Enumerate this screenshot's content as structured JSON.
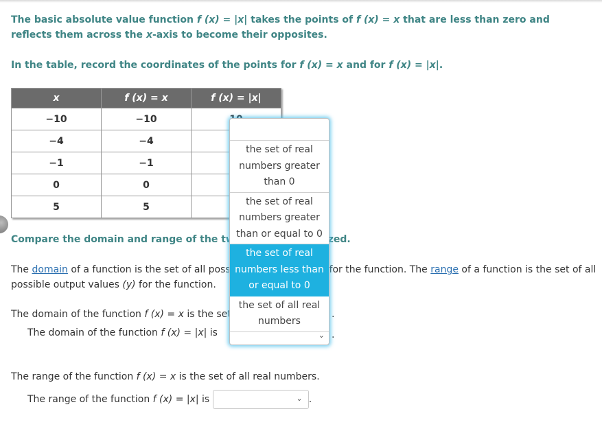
{
  "intro": {
    "text_a": "The basic absolute value function ",
    "fx_abs": "f (x) = |x|",
    "text_b": " takes the points of ",
    "fx_id": "f (x) = x",
    "text_c": " that are less than zero and reflects them across the ",
    "xvar": "x",
    "text_d": "-axis to become their opposites."
  },
  "instruction": {
    "text_a": "In the table, record the coordinates of the points for ",
    "fx_id": "f (x) = x",
    "text_b": " and for ",
    "fx_abs": "f (x) = |x|",
    "text_c": "."
  },
  "table": {
    "headers": [
      "x",
      "f (x) = x",
      "f (x) = |x|"
    ],
    "rows": [
      [
        "−10",
        "−10",
        "10"
      ],
      [
        "−4",
        "−4",
        ""
      ],
      [
        "−1",
        "−1",
        ""
      ],
      [
        "0",
        "0",
        ""
      ],
      [
        "5",
        "5",
        ""
      ]
    ]
  },
  "compare": {
    "heading": "Compare the domain and range of the two functions analyzed."
  },
  "definitions": {
    "text_a": "The ",
    "domain_link": "domain",
    "text_b": " of a function is the set of all possible input values (x) for the function. The ",
    "range_link": "range",
    "text_c": " of a function is the set of all possible output values ",
    "yvar": "(y)",
    "text_d": " for the function."
  },
  "domain": {
    "line1_a": "The domain of the function ",
    "line1_fx": "f (x) = x",
    "line1_b": " is the set of all real numbers.",
    "line2_a": "The domain of the function ",
    "line2_fx": "f (x) = |x|",
    "line2_b": " is",
    "selected_value": ""
  },
  "range": {
    "line1_a": "The range of the function ",
    "line1_fx": "f (x) = x",
    "line1_b": " is the set of all real numbers.",
    "line2_a": "The range of the function ",
    "line2_fx": "f (x) = |x|",
    "line2_b": " is",
    "selected_value": ""
  },
  "dropdown_options": [
    "",
    "the set of real numbers greater than  0",
    "the set of real numbers greater than or equal to  0",
    "the set of real numbers less than or equal to  0",
    "the set of all real numbers"
  ],
  "highlighted_option_index": 3,
  "icons": {
    "chevron": "chevron-down-icon",
    "bubble": "hint-bubble-icon"
  },
  "colors": {
    "heading": "#3f8585",
    "highlight": "#1eb1e0",
    "table_header": "#6b6b6b",
    "link": "#2a6fb0"
  }
}
